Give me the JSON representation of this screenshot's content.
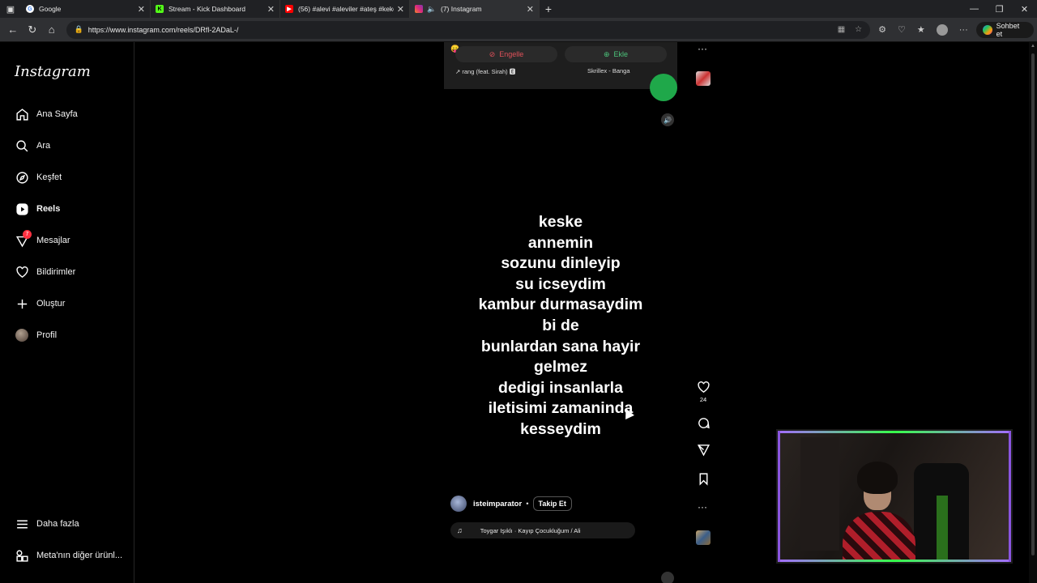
{
  "browser": {
    "tabs": [
      {
        "title": "Google",
        "favicon": "google-icon",
        "color": "#4285f4"
      },
      {
        "title": "Stream - Kick Dashboard",
        "favicon": "kick-icon",
        "color": "#53fc18"
      },
      {
        "title": "(56) #alevi #aleviler #ateş #keko",
        "favicon": "youtube-icon",
        "color": "#ff0000"
      },
      {
        "title": "(7) Instagram",
        "favicon": "instagram-icon",
        "color": "#e1306c"
      }
    ],
    "url": "https://www.instagram.com/reels/DRfl-2ADaL-/",
    "copilot_label": "Sohbet et"
  },
  "sidebar": {
    "logo": "Instagram",
    "items": [
      {
        "label": "Ana Sayfa",
        "icon": "home-icon"
      },
      {
        "label": "Ara",
        "icon": "search-icon"
      },
      {
        "label": "Keşfet",
        "icon": "explore-icon"
      },
      {
        "label": "Reels",
        "icon": "reels-icon"
      },
      {
        "label": "Mesajlar",
        "icon": "messages-icon",
        "badge": "7"
      },
      {
        "label": "Bildirimler",
        "icon": "heart-icon"
      },
      {
        "label": "Oluştur",
        "icon": "plus-icon"
      },
      {
        "label": "Profil",
        "icon": "avatar"
      }
    ],
    "more_label": "Daha fazla",
    "meta_label": "Meta'nın diğer ürünl..."
  },
  "reel": {
    "top_fragment": {
      "block_label": "Engelle",
      "add_label": "Ekle",
      "song_left": "rang (feat. Sirah)",
      "song_right": "Skrillex - Banga"
    },
    "lines": [
      "keske",
      "annemin",
      "sozunu dinleyip",
      "su icseydim",
      "kambur durmasaydim",
      "bi de",
      "bunlardan sana hayir",
      "gelmez",
      "dedigi insanlarla",
      "iletisimi zamaninda",
      "kesseydim"
    ],
    "username": "isteimparator",
    "follow_label": "Takip Et",
    "music": "Toygar Işıklı · Kayıp Çocukluğum / Ali",
    "likes": "24"
  }
}
